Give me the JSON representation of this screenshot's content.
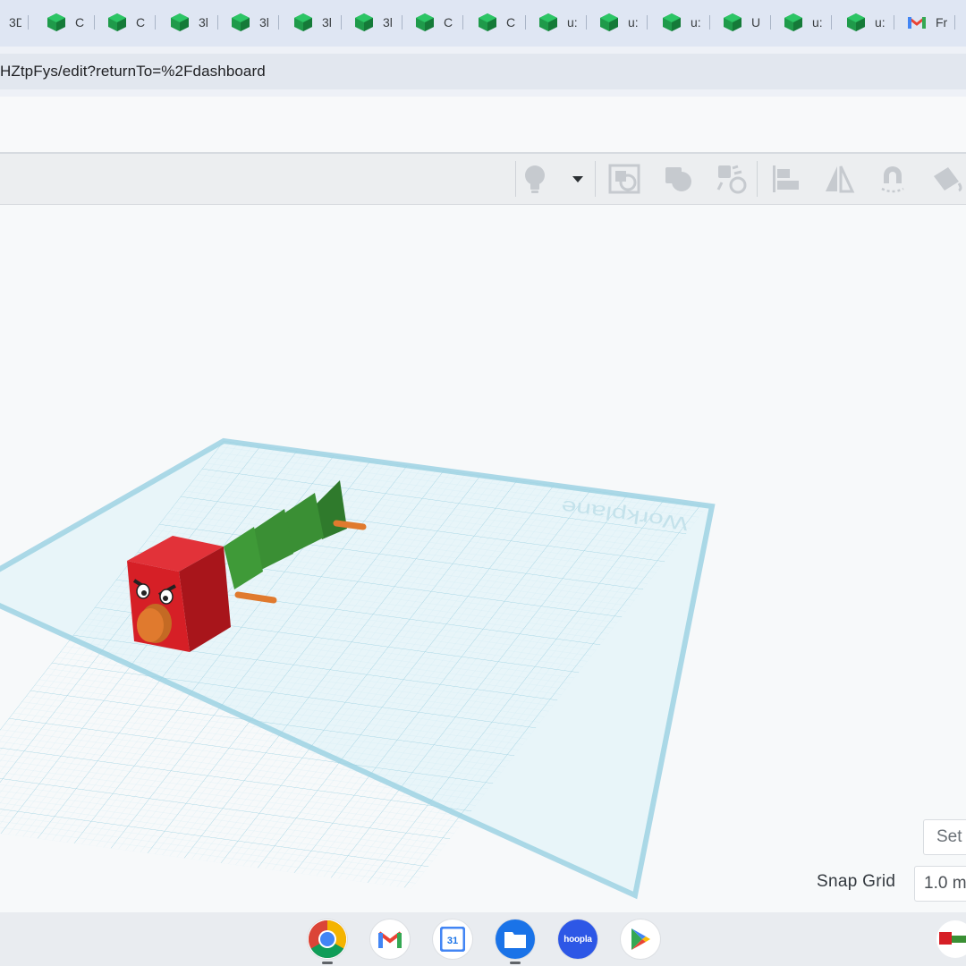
{
  "browser": {
    "tabs": [
      {
        "title": "3D",
        "icon": "tinkercad-icon"
      },
      {
        "title": "C",
        "icon": "tinkercad-icon"
      },
      {
        "title": "C",
        "icon": "tinkercad-icon"
      },
      {
        "title": "3l",
        "icon": "tinkercad-icon"
      },
      {
        "title": "3l",
        "icon": "tinkercad-icon"
      },
      {
        "title": "3l",
        "icon": "tinkercad-icon"
      },
      {
        "title": "3l",
        "icon": "tinkercad-icon"
      },
      {
        "title": "C",
        "icon": "tinkercad-icon"
      },
      {
        "title": "C",
        "icon": "tinkercad-icon"
      },
      {
        "title": "u:",
        "icon": "tinkercad-icon"
      },
      {
        "title": "u:",
        "icon": "tinkercad-icon"
      },
      {
        "title": "u:",
        "icon": "tinkercad-icon"
      },
      {
        "title": "U",
        "icon": "tinkercad-icon"
      },
      {
        "title": "u:",
        "icon": "tinkercad-icon"
      },
      {
        "title": "u:",
        "icon": "tinkercad-icon"
      },
      {
        "title": "Fr",
        "icon": "gmail-icon"
      }
    ],
    "url": "HZtpFys/edit?returnTo=%2Fdashboard"
  },
  "toolbar": {
    "tools": [
      "note-icon",
      "dropdown-arrow-icon",
      "view-fit-icon",
      "group-icon",
      "ungroup-icon",
      "align-icon",
      "mirror-icon",
      "cruise-magnet-icon",
      "paint-icon"
    ]
  },
  "workplane": {
    "label": "Workplane"
  },
  "viewport": {
    "settings_label": "Set",
    "snap_grid_label": "Snap Grid",
    "snap_grid_value": "1.0 m"
  },
  "shelf": {
    "apps": [
      "chrome-icon",
      "gmail-icon",
      "calendar-icon",
      "files-icon",
      "hoopla-icon",
      "play-store-icon"
    ],
    "calendar_day": "31",
    "hoopla_label": "hoopla"
  },
  "colors": {
    "tinkercad_green": "#1f9a4a",
    "head_red": "#d61f26",
    "body_green": "#3a8f34",
    "peg_orange": "#e07a2e",
    "grid_blue": "#a9dcea"
  }
}
